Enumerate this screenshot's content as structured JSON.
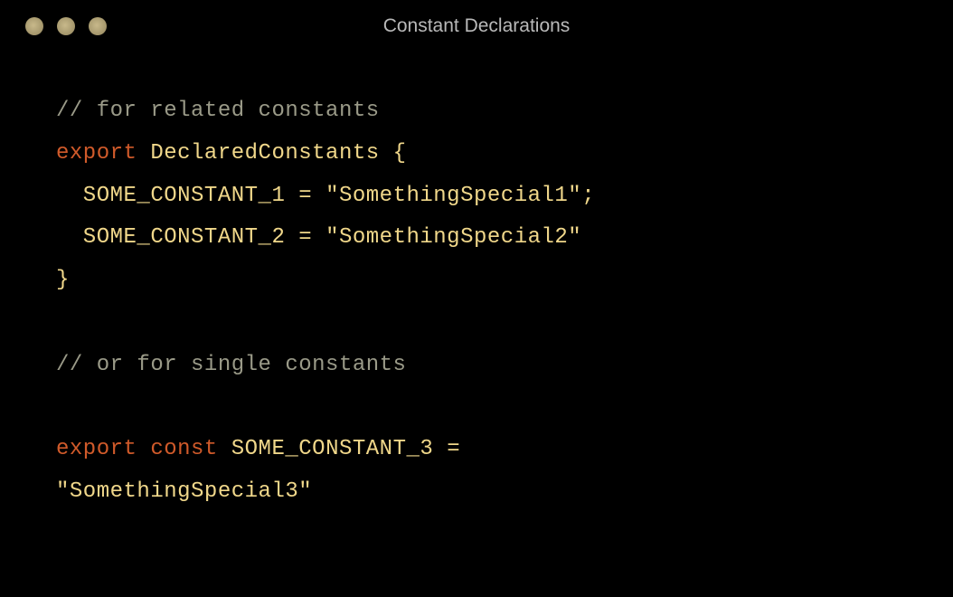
{
  "window": {
    "title": "Constant Declarations"
  },
  "code": {
    "lines": [
      {
        "tokens": [
          {
            "cls": "comment",
            "text": "// for related constants"
          }
        ]
      },
      {
        "tokens": [
          {
            "cls": "keyword",
            "text": "export"
          },
          {
            "cls": "identifier",
            "text": " DeclaredConstants "
          },
          {
            "cls": "brace",
            "text": "{"
          }
        ]
      },
      {
        "tokens": [
          {
            "cls": "property",
            "text": "  SOME_CONSTANT_1 "
          },
          {
            "cls": "operator",
            "text": "= "
          },
          {
            "cls": "string",
            "text": "\"SomethingSpecial1\""
          },
          {
            "cls": "punct",
            "text": ";"
          }
        ]
      },
      {
        "tokens": [
          {
            "cls": "property",
            "text": "  SOME_CONSTANT_2 "
          },
          {
            "cls": "operator",
            "text": "= "
          },
          {
            "cls": "string",
            "text": "\"SomethingSpecial2\""
          }
        ]
      },
      {
        "tokens": [
          {
            "cls": "brace",
            "text": "}"
          }
        ]
      },
      {
        "tokens": [
          {
            "cls": "comment",
            "text": " "
          }
        ]
      },
      {
        "tokens": [
          {
            "cls": "comment",
            "text": "// or for single constants"
          }
        ]
      },
      {
        "tokens": [
          {
            "cls": "comment",
            "text": " "
          }
        ]
      },
      {
        "tokens": [
          {
            "cls": "keyword",
            "text": "export"
          },
          {
            "cls": "keyword",
            "text": " const"
          },
          {
            "cls": "identifier",
            "text": " SOME_CONSTANT_3 "
          },
          {
            "cls": "operator",
            "text": "="
          }
        ]
      },
      {
        "tokens": [
          {
            "cls": "string",
            "text": "\"SomethingSpecial3\""
          }
        ]
      }
    ]
  }
}
